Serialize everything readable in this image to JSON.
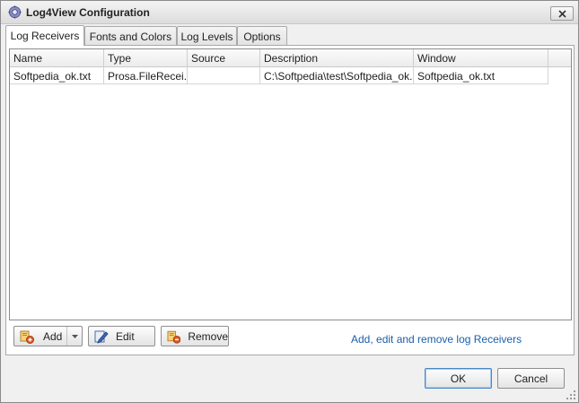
{
  "window": {
    "title": "Log4View Configuration",
    "icon": "gear-icon"
  },
  "tabs": [
    {
      "label": "Log Receivers",
      "active": true
    },
    {
      "label": "Fonts and Colors",
      "active": false
    },
    {
      "label": "Log Levels",
      "active": false
    },
    {
      "label": "Options",
      "active": false
    }
  ],
  "grid": {
    "columns": [
      "Name",
      "Type",
      "Source",
      "Description",
      "Window"
    ],
    "rows": [
      [
        "Softpedia_ok.txt",
        "Prosa.FileRecei...",
        "",
        "C:\\Softpedia\\test\\Softpedia_ok...",
        "Softpedia_ok.txt"
      ]
    ]
  },
  "actions": {
    "add_label": "Add",
    "edit_label": "Edit",
    "remove_label": "Remove",
    "hint": "Add, edit and remove log Receivers"
  },
  "dialog": {
    "ok_label": "OK",
    "cancel_label": "Cancel"
  },
  "colors": {
    "link": "#1b5faa",
    "accent": "#4a86c6"
  }
}
